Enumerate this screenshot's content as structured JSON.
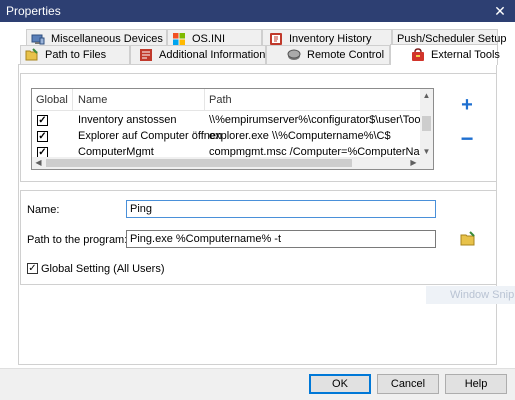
{
  "window": {
    "title": "Properties",
    "close_glyph": "✕"
  },
  "tabs_row1": [
    {
      "label": "Miscellaneous Devices",
      "icon": "devices-icon"
    },
    {
      "label": "OS.INI",
      "icon": "windows-logo-icon"
    },
    {
      "label": "Inventory History",
      "icon": "history-icon"
    },
    {
      "label": "Push/Scheduler Setup",
      "icon": ""
    }
  ],
  "tabs_row2": [
    {
      "label": "Path to Files",
      "icon": "folder-icon"
    },
    {
      "label": "Additional Information",
      "icon": "info-card-icon"
    },
    {
      "label": "Remote Control",
      "icon": "remote-control-icon"
    },
    {
      "label": "External Tools",
      "icon": "tools-bag-icon",
      "active": true
    }
  ],
  "tools_list": {
    "columns": [
      "Global",
      "Name",
      "Path"
    ],
    "rows": [
      {
        "global": true,
        "name": "Inventory anstossen",
        "path": "\\\\%empirumserver%\\configurator$\\user\\Tools\\Remo"
      },
      {
        "global": true,
        "name": "Explorer auf Computer öffnen",
        "path": "explorer.exe \\\\%Computername%\\C$"
      },
      {
        "global": true,
        "name": "ComputerMgmt",
        "path": "compmgmt.msc /Computer=%ComputerName%"
      }
    ],
    "check_glyph": "✓"
  },
  "list_actions": {
    "add_glyph": "+",
    "remove_glyph": "−"
  },
  "form": {
    "name_label": "Name:",
    "name_value": "Ping",
    "path_label": "Path to the program:",
    "path_value": "Ping.exe %Computername% -t",
    "global_label": "Global Setting (All Users)",
    "global_checked": true,
    "check_glyph": "✓"
  },
  "watermark": "Window Snip",
  "buttons": {
    "ok": "OK",
    "cancel": "Cancel",
    "help": "Help"
  },
  "colors": {
    "titlebar": "#2d3f72",
    "accent": "#0078d7",
    "add_remove": "#1e6fd0"
  }
}
